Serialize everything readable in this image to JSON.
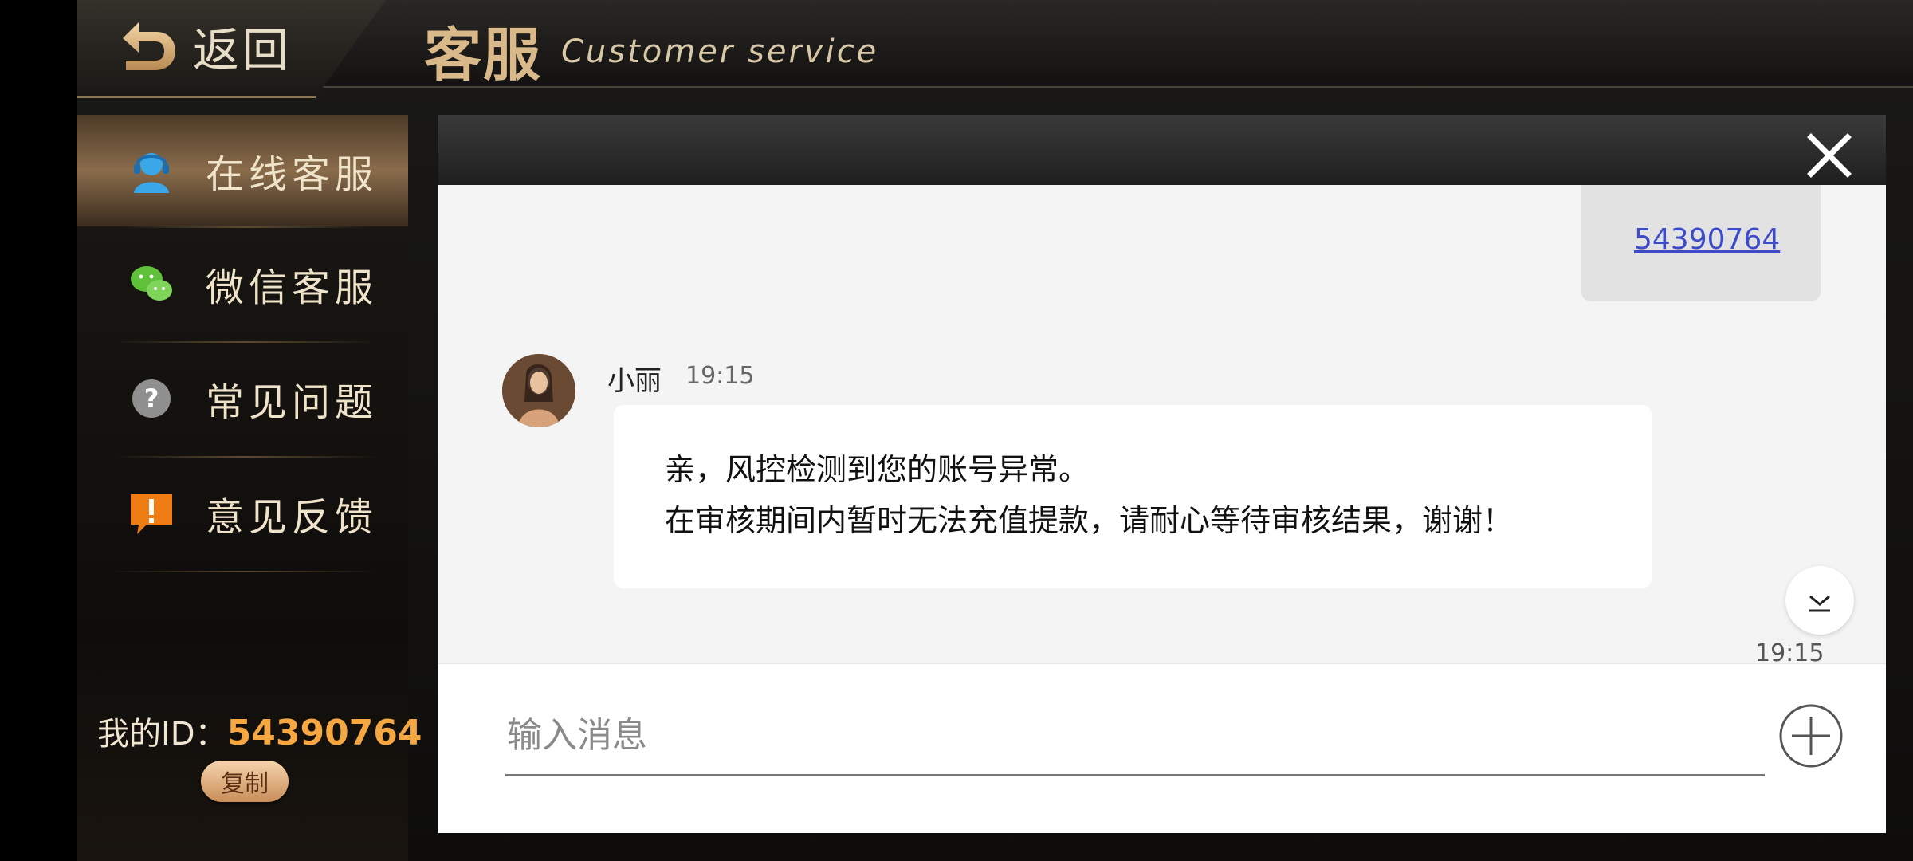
{
  "header": {
    "back_label": "返回",
    "title": "客服",
    "subtitle": "Customer service"
  },
  "sidebar": {
    "items": [
      {
        "label": "在线客服",
        "icon": "headset-agent-icon",
        "active": true
      },
      {
        "label": "微信客服",
        "icon": "wechat-icon",
        "active": false
      },
      {
        "label": "常见问题",
        "icon": "question-icon",
        "active": false
      },
      {
        "label": "意见反馈",
        "icon": "feedback-exclamation-icon",
        "active": false
      }
    ],
    "my_id_label": "我的ID：",
    "my_id_value": "54390764",
    "copy_label": "复制"
  },
  "chat": {
    "outgoing": {
      "text": "54390764"
    },
    "incoming": {
      "sender": "小丽",
      "time": "19:15",
      "lines": [
        "亲，风控检测到您的账号异常。",
        "在审核期间内暂时无法充值提款，请耐心等待审核结果，谢谢！"
      ]
    },
    "bottom_timestamp": "19:15",
    "input_placeholder": "输入消息",
    "input_value": ""
  },
  "colors": {
    "accent_gold": "#d9b98a",
    "id_orange": "#f5a742",
    "link_blue": "#3d4bc9"
  }
}
